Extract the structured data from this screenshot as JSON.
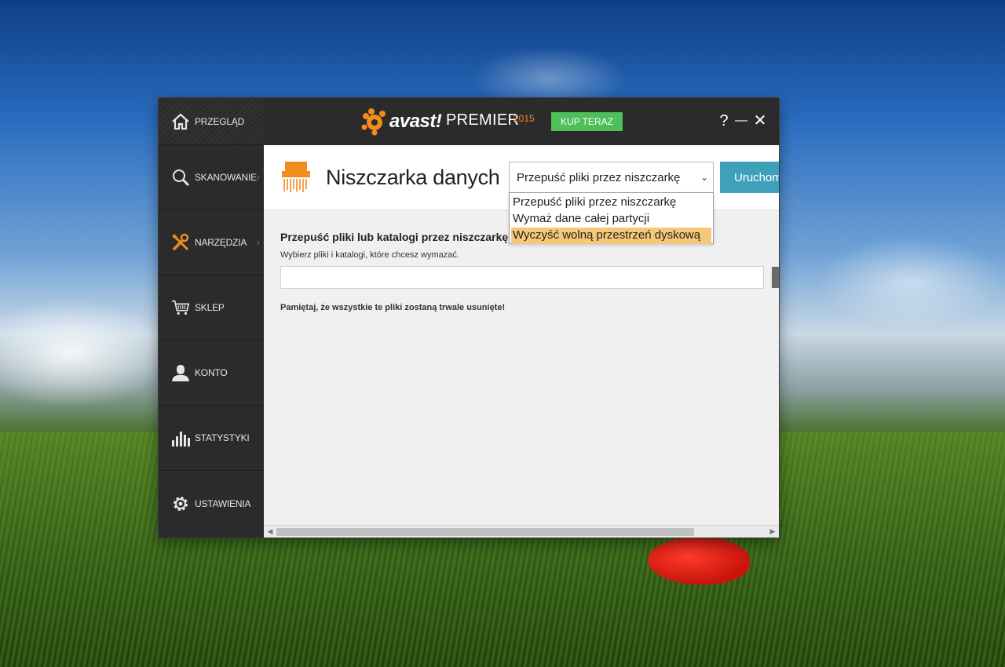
{
  "colors": {
    "accent_orange": "#f28c1e",
    "buy_green": "#4fbf5a",
    "run_teal": "#3fa0b9",
    "dark_bg": "#2b2b2b",
    "selected_option": "#f5c877"
  },
  "sidebar": {
    "items": [
      {
        "label": "PRZEGLĄD",
        "icon": "home-icon"
      },
      {
        "label": "SKANOWANIE",
        "icon": "magnifier-icon",
        "has_submenu": true
      },
      {
        "label": "NARZĘDZIA",
        "icon": "tools-icon",
        "has_submenu": true
      },
      {
        "label": "SKLEP",
        "icon": "cart-icon"
      },
      {
        "label": "KONTO",
        "icon": "user-icon"
      },
      {
        "label": "STATYSTYKI",
        "icon": "bar-chart-icon"
      },
      {
        "label": "USTAWIENIA",
        "icon": "gear-icon"
      }
    ]
  },
  "titlebar": {
    "logo_text": "avast!",
    "product": "PREMIER",
    "year": "2015",
    "buy_label": "KUP TERAZ",
    "help": "?",
    "minimize": "—",
    "close": "✕"
  },
  "header": {
    "title": "Niszczarka danych",
    "icon": "shredder-icon",
    "select_value": "Przepuść pliki przez niszczarkę",
    "run_label": "Uruchom"
  },
  "dropdown": {
    "options": [
      "Przepuść pliki przez niszczarkę",
      "Wymaż dane całej partycji",
      "Wyczyść wolną przestrzeń dyskową"
    ],
    "highlighted_index": 2
  },
  "content": {
    "section_title": "Przepuść pliki lub katalogi przez niszczarkę",
    "section_sub": "Wybierz pliki i katalogi, które chcesz wymazać.",
    "path_value": "",
    "warning": "Pamiętaj, że wszystkie te pliki zostaną trwale usunięte!"
  }
}
